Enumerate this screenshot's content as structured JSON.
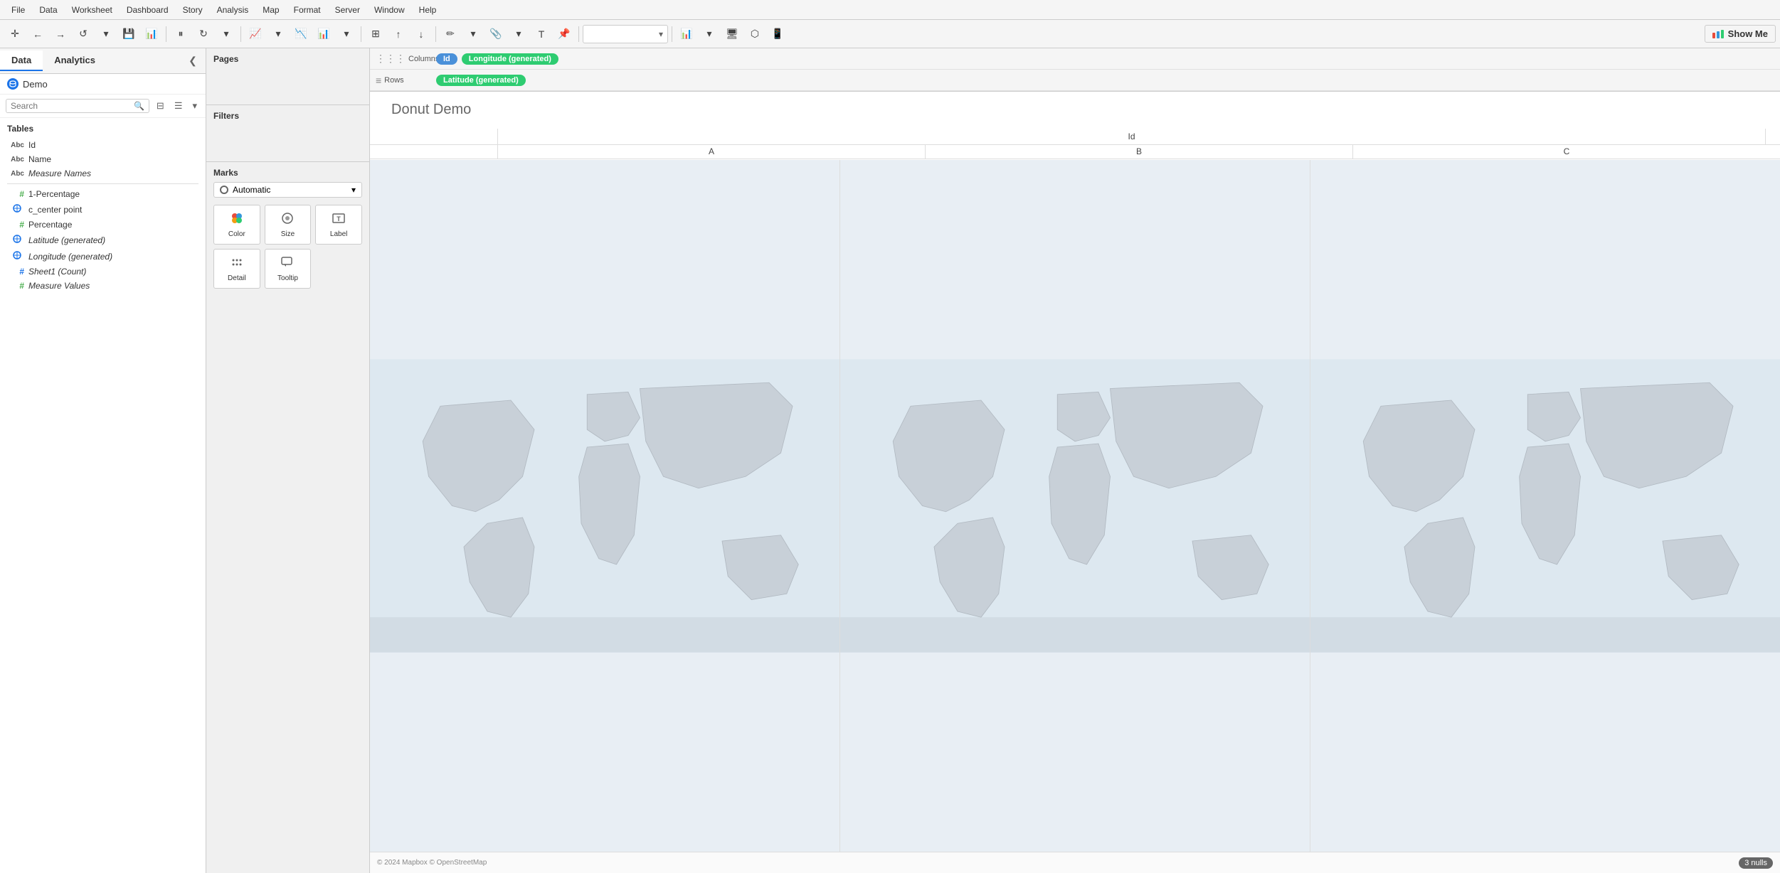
{
  "menu": {
    "items": [
      "File",
      "Data",
      "Worksheet",
      "Dashboard",
      "Story",
      "Analysis",
      "Map",
      "Format",
      "Server",
      "Window",
      "Help"
    ]
  },
  "tabs": {
    "data_label": "Data",
    "analytics_label": "Analytics"
  },
  "datasource": {
    "name": "Demo"
  },
  "search": {
    "placeholder": "Search"
  },
  "tables": {
    "label": "Tables",
    "fields": [
      {
        "type": "abc",
        "name": "Id",
        "italic": false
      },
      {
        "type": "abc",
        "name": "Name",
        "italic": false
      },
      {
        "type": "abc",
        "name": "Measure Names",
        "italic": true
      },
      {
        "type": "hash",
        "name": "1-Percentage",
        "italic": false
      },
      {
        "type": "geo",
        "name": "c_center point",
        "italic": false
      },
      {
        "type": "hash",
        "name": "Percentage",
        "italic": false
      },
      {
        "type": "geo",
        "name": "Latitude (generated)",
        "italic": true
      },
      {
        "type": "geo",
        "name": "Longitude (generated)",
        "italic": true
      },
      {
        "type": "hash",
        "name": "Sheet1 (Count)",
        "italic": true
      },
      {
        "type": "hash",
        "name": "Measure Values",
        "italic": true
      }
    ]
  },
  "pages": {
    "label": "Pages"
  },
  "filters": {
    "label": "Filters"
  },
  "marks": {
    "label": "Marks",
    "type": "Automatic",
    "buttons": [
      {
        "icon": "⬛",
        "label": "Color"
      },
      {
        "icon": "⬜",
        "label": "Size"
      },
      {
        "icon": "T",
        "label": "Label"
      },
      {
        "icon": "⠿",
        "label": "Detail"
      },
      {
        "icon": "💬",
        "label": "Tooltip"
      }
    ]
  },
  "shelves": {
    "columns_label": "Columns",
    "rows_label": "Rows",
    "columns_pills": [
      "Id",
      "Longitude (generated)"
    ],
    "rows_pills": [
      "Latitude (generated)"
    ]
  },
  "chart": {
    "title": "Donut Demo",
    "id_header": "Id",
    "col_headers": [
      "A",
      "B",
      "C"
    ],
    "footer": "© 2024 Mapbox © OpenStreetMap",
    "nulls_badge": "3 nulls"
  },
  "show_me": {
    "label": "Show Me"
  }
}
